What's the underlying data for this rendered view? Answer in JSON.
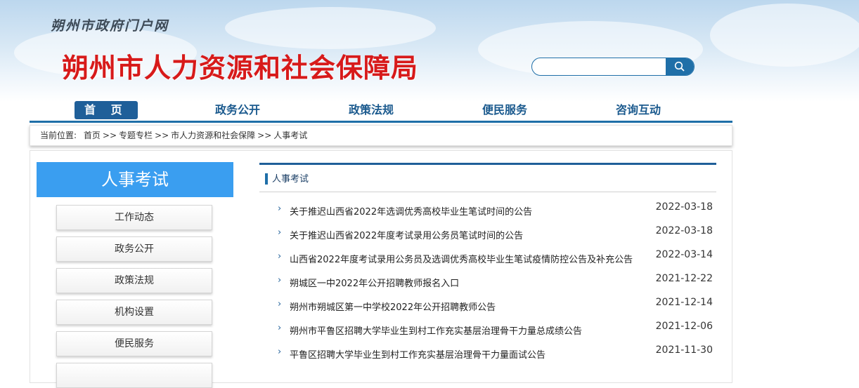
{
  "header": {
    "portal_name": "朔州市政府门户网",
    "bureau_name": "朔州市人力资源和社会保障局",
    "search": {
      "placeholder": "",
      "icon": "search-icon"
    }
  },
  "nav": {
    "items": [
      {
        "label": "首 页",
        "active": true
      },
      {
        "label": "政务公开",
        "active": false
      },
      {
        "label": "政策法规",
        "active": false
      },
      {
        "label": "便民服务",
        "active": false
      },
      {
        "label": "咨询互动",
        "active": false
      }
    ]
  },
  "breadcrumb": {
    "prefix": "当前位置:",
    "items": [
      "首页",
      "专题专栏",
      "市人力资源和社会保障",
      "人事考试"
    ],
    "separator": ">>"
  },
  "sidebar": {
    "title": "人事考试",
    "items": [
      "工作动态",
      "政务公开",
      "政策法规",
      "机构设置",
      "便民服务"
    ]
  },
  "list": {
    "heading": "人事考试",
    "rows": [
      {
        "title": "关于推迟山西省2022年选调优秀高校毕业生笔试时间的公告",
        "date": "2022-03-18"
      },
      {
        "title": "关于推迟山西省2022年度考试录用公务员笔试时间的公告",
        "date": "2022-03-18"
      },
      {
        "title": "山西省2022年度考试录用公务员及选调优秀高校毕业生笔试疫情防控公告及补充公告",
        "date": "2022-03-14"
      },
      {
        "title": "朔城区一中2022年公开招聘教师报名入口",
        "date": "2021-12-22"
      },
      {
        "title": "朔州市朔城区第一中学校2022年公开招聘教师公告",
        "date": "2021-12-14"
      },
      {
        "title": "朔州市平鲁区招聘大学毕业生到村工作充实基层治理骨干力量总成绩公告",
        "date": "2021-12-06"
      },
      {
        "title": "平鲁区招聘大学毕业生到村工作充实基层治理骨干力量面试公告",
        "date": "2021-11-30"
      }
    ]
  },
  "colors": {
    "brand_red": "#d71a1a",
    "nav_blue": "#1f5f99",
    "sidebar_blue": "#3a9ef0"
  }
}
